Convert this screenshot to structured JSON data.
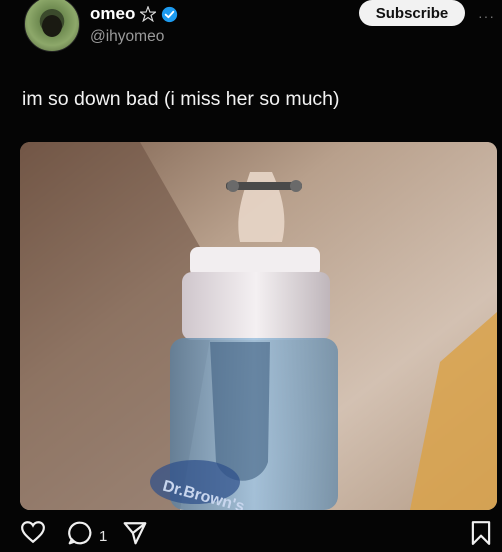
{
  "post": {
    "display_name": "omeo",
    "handle": "@ihyomeo",
    "text": "im so down bad (i miss her so much)",
    "subscribe_label": "Subscribe",
    "more_label": "···"
  },
  "actions": {
    "reply_count": "1"
  },
  "colors": {
    "background": "#050505",
    "verified": "#1d9bf0",
    "handle": "#9a9a9a",
    "subscribe_bg": "#f2f2f2"
  },
  "icons": {
    "badge": "pentagram-icon",
    "verified": "verified-check-icon",
    "like": "heart-icon",
    "reply": "comment-bubble-icon",
    "share": "send-arrow-icon",
    "save": "bookmark-icon"
  }
}
